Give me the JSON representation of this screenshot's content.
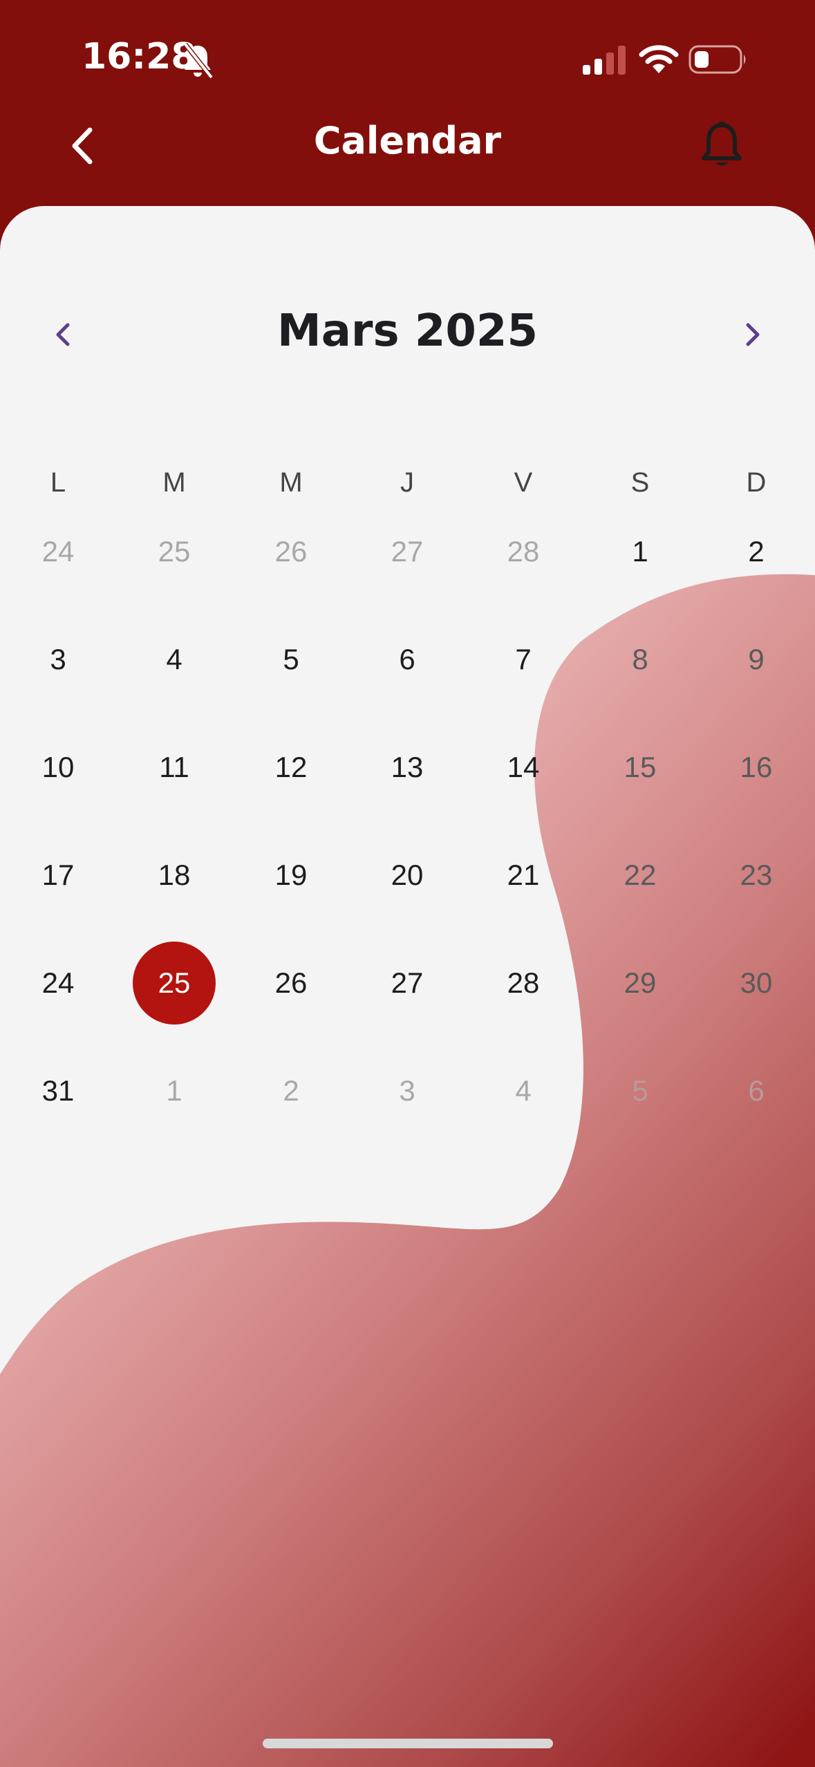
{
  "status_bar": {
    "time": "16:28"
  },
  "header": {
    "title": "Calendar"
  },
  "calendar": {
    "month_title": "Mars 2025",
    "weekdays": [
      "L",
      "M",
      "M",
      "J",
      "V",
      "S",
      "D"
    ],
    "weeks": [
      [
        "24",
        "25",
        "26",
        "27",
        "28",
        "1",
        "2"
      ],
      [
        "3",
        "4",
        "5",
        "6",
        "7",
        "8",
        "9"
      ],
      [
        "10",
        "11",
        "12",
        "13",
        "14",
        "15",
        "16"
      ],
      [
        "17",
        "18",
        "19",
        "20",
        "21",
        "22",
        "23"
      ],
      [
        "24",
        "25",
        "26",
        "27",
        "28",
        "29",
        "30"
      ],
      [
        "31",
        "1",
        "2",
        "3",
        "4",
        "5",
        "6"
      ]
    ],
    "selected_day": "25"
  },
  "colors": {
    "brand": "#820f0b",
    "selected": "#b3140f",
    "nav_arrows": "#5b3f8f",
    "background": "#f4f4f4"
  },
  "icons": {
    "back": "chevron-left-icon",
    "notifications": "bell-icon",
    "previous": "chevron-left-icon",
    "next": "chevron-right-icon",
    "silent": "bell-slash-icon"
  }
}
